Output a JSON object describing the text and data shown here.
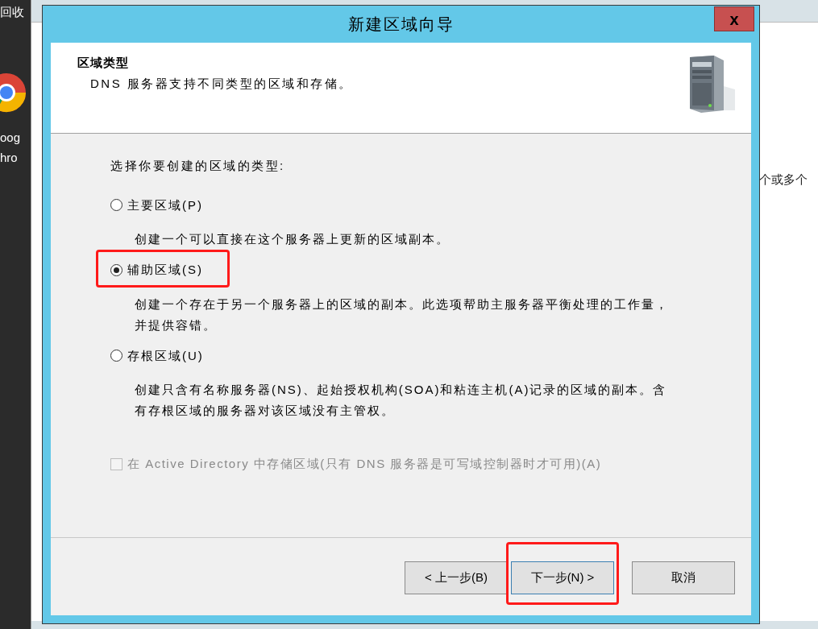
{
  "desktop": {
    "labels": [
      "回收",
      "oog",
      "hro"
    ]
  },
  "background_window": {
    "text": "个或多个"
  },
  "dialog": {
    "title": "新建区域向导",
    "close": "x",
    "header": {
      "title": "区域类型",
      "subtitle": "DNS 服务器支持不同类型的区域和存储。"
    },
    "prompt": "选择你要创建的区域的类型:",
    "options": [
      {
        "label": "主要区域(P)",
        "description": "创建一个可以直接在这个服务器上更新的区域副本。",
        "selected": false,
        "highlighted": false
      },
      {
        "label": "辅助区域(S)",
        "description": "创建一个存在于另一个服务器上的区域的副本。此选项帮助主服务器平衡处理的工作量，并提供容错。",
        "selected": true,
        "highlighted": true
      },
      {
        "label": "存根区域(U)",
        "description": "创建只含有名称服务器(NS)、起始授权机构(SOA)和粘连主机(A)记录的区域的副本。含有存根区域的服务器对该区域没有主管权。",
        "selected": false,
        "highlighted": false
      }
    ],
    "store_in_ad": {
      "label": "在 Active Directory 中存储区域(只有 DNS 服务器是可写域控制器时才可用)(A)",
      "checked": false,
      "disabled": true
    },
    "buttons": [
      {
        "label": "< 上一步(B)",
        "focused": false,
        "highlighted": false
      },
      {
        "label": "下一步(N) >",
        "focused": true,
        "highlighted": true
      },
      {
        "label": "取消",
        "focused": false,
        "highlighted": false
      }
    ]
  }
}
